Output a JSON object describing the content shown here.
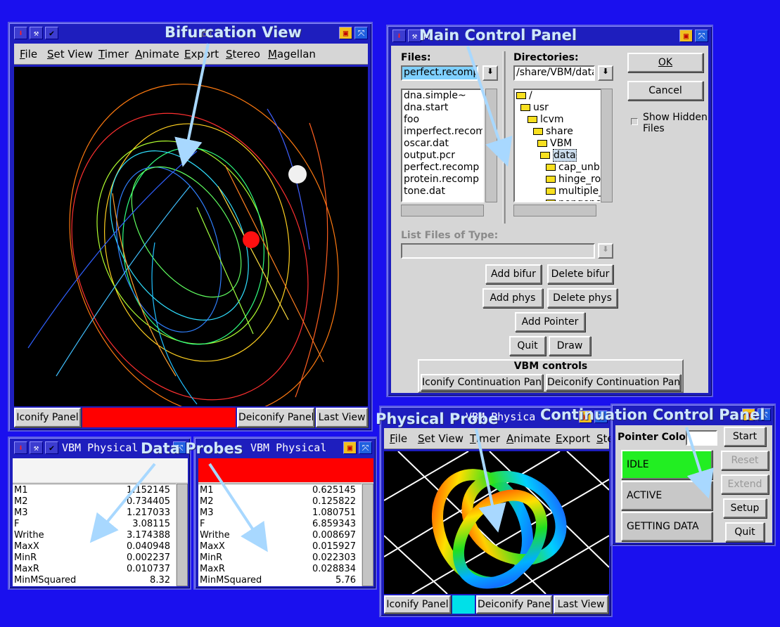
{
  "annotations": {
    "bifurcation": "Bifurcation View",
    "main_control": "Main Control Panel",
    "data_probes": "Data Probes",
    "physical_probe": "Physical Probe",
    "continuation": "Continuation Control Panel"
  },
  "bif_window": {
    "title": "Bif",
    "menu": [
      "File",
      "Set View",
      "Timer",
      "Animate",
      "Export",
      "Stereo",
      "Magellan"
    ],
    "buttons": {
      "iconify": "Iconify Panel",
      "deiconify": "Deiconify Panel",
      "last_view": "Last View"
    },
    "status_color": "#ff0000"
  },
  "main_panel": {
    "title": "M",
    "files_label": "Files:",
    "files_value": "perfect.recomp",
    "files": [
      "dna.simple~",
      "dna.start",
      "foo",
      "imperfect.recomp",
      "oscar.dat",
      "output.pcr",
      "perfect.recomp",
      "protein.recomp",
      "tone.dat"
    ],
    "dirs_label": "Directories:",
    "dirs_value": "/share/VBM/data",
    "dirs": [
      "/",
      "usr",
      "lcvm",
      "share",
      "VBM",
      "data",
      "cap_unb",
      "hinge_ro",
      "multiple_",
      "nongene"
    ],
    "ok": "OK",
    "cancel": "Cancel",
    "show_hidden": "Show Hidden Files",
    "list_type_label": "List Files of Type:",
    "add_bifur": "Add bifur",
    "delete_bifur": "Delete bifur",
    "add_phys": "Add phys",
    "delete_phys": "Delete phys",
    "add_pointer": "Add Pointer",
    "quit": "Quit",
    "draw": "Draw",
    "vbm_controls": "VBM controls",
    "iconify_cont": "Iconify Continuation Panel",
    "deiconify_cont": "Deiconify Continuation Panel"
  },
  "probe1": {
    "title": "VBM Physical",
    "header_color": "#f4f4f4",
    "rows": [
      {
        "name": "M1",
        "value": "1.152145"
      },
      {
        "name": "M2",
        "value": "0.734405"
      },
      {
        "name": "M3",
        "value": "1.217033"
      },
      {
        "name": "F",
        "value": "3.08115"
      },
      {
        "name": "Writhe",
        "value": "3.174388"
      },
      {
        "name": "MaxX",
        "value": "0.040948"
      },
      {
        "name": "MinR",
        "value": "0.002237"
      },
      {
        "name": "MaxR",
        "value": "0.010737"
      },
      {
        "name": "MinMSquared",
        "value": "8.32"
      }
    ]
  },
  "probe2": {
    "title": "VBM Physical",
    "header_color": "#ff0000",
    "rows": [
      {
        "name": "M1",
        "value": "0.625145"
      },
      {
        "name": "M2",
        "value": "0.125822"
      },
      {
        "name": "M3",
        "value": "1.080751"
      },
      {
        "name": "F",
        "value": "6.859343"
      },
      {
        "name": "Writhe",
        "value": "0.008697"
      },
      {
        "name": "MaxX",
        "value": "0.015927"
      },
      {
        "name": "MinR",
        "value": "0.022303"
      },
      {
        "name": "MaxR",
        "value": "0.028834"
      },
      {
        "name": "MinMSquared",
        "value": "5.76"
      }
    ]
  },
  "phys_window": {
    "title": "VBM Physica",
    "menu": [
      "File",
      "Set View",
      "Timer",
      "Animate",
      "Export",
      "Ster"
    ],
    "buttons": {
      "iconify": "Iconify Panel",
      "deiconify": "Deiconify Panel",
      "last_view": "Last View"
    },
    "status_color": "#00e0e8"
  },
  "cont_panel": {
    "pointer_color_label": "Pointer Color",
    "states": {
      "idle": "IDLE",
      "active": "ACTIVE",
      "getting": "GETTING DATA"
    },
    "idle_color": "#22ee22",
    "buttons": {
      "start": "Start",
      "reset": "Reset",
      "extend": "Extend",
      "setup": "Setup",
      "quit": "Quit"
    }
  }
}
